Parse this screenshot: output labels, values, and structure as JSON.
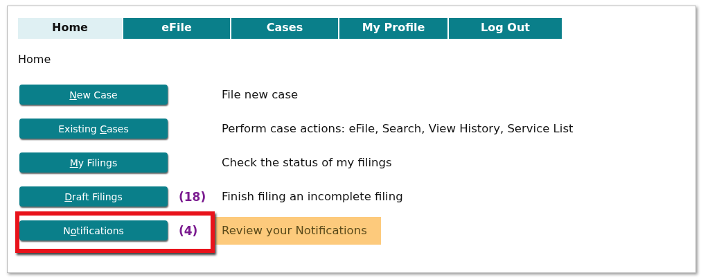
{
  "tabs": [
    {
      "label": "Home",
      "selected": true
    },
    {
      "label": "eFile",
      "selected": false
    },
    {
      "label": "Cases",
      "selected": false
    },
    {
      "label": "My Profile",
      "selected": false
    },
    {
      "label": "Log Out",
      "selected": false
    }
  ],
  "breadcrumb": "Home",
  "actions": [
    {
      "label": {
        "key": "N",
        "after": "ew Case"
      },
      "description": "File new case",
      "highlighted": false,
      "callout": false
    },
    {
      "label": {
        "before": "Existing ",
        "key": "C",
        "after": "ases"
      },
      "description": "Perform case actions: eFile, Search, View History, Service List",
      "highlighted": false,
      "callout": false
    },
    {
      "label": {
        "key": "M",
        "after": "y Filings"
      },
      "description": "Check the status of my filings",
      "highlighted": false,
      "callout": false
    },
    {
      "label": {
        "key": "D",
        "after": "raft Filings"
      },
      "count": "(18)",
      "description": "Finish filing an incomplete filing",
      "highlighted": false,
      "callout": false
    },
    {
      "label": {
        "before": "N",
        "key": "o",
        "after": "tifications"
      },
      "count": "(4)",
      "description": "Review your Notifications",
      "highlighted": true,
      "callout": true
    }
  ]
}
